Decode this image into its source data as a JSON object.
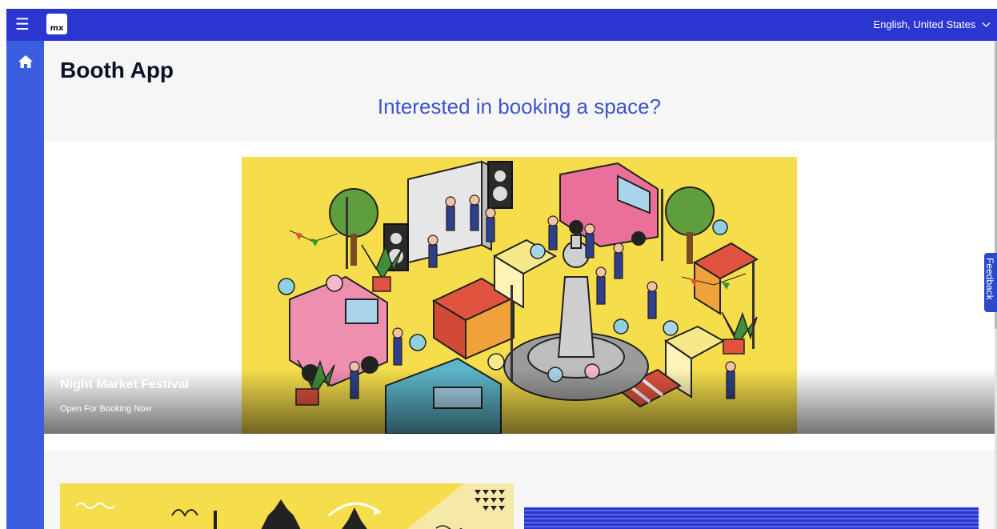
{
  "topbar": {
    "logo_text": "mx",
    "language": "English, United States",
    "menu_icon": "hamburger-menu-icon",
    "chevron_icon": "chevron-down-icon",
    "color": "#2b36d1"
  },
  "sidebar": {
    "home_icon": "home-icon",
    "color": "#3a5de0"
  },
  "page": {
    "title": "Booth App",
    "headline": "Interested in booking a space?",
    "headline_color": "#3d54ce"
  },
  "featured_event": {
    "name": "Night Market Festival",
    "status": "Open For Booking Now",
    "illustration_bg": "#f5dd4b"
  },
  "feedback": {
    "label": "Feedback"
  }
}
